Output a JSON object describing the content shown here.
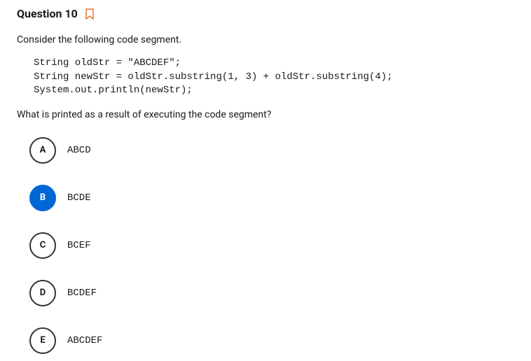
{
  "header": {
    "title": "Question 10"
  },
  "prompt": {
    "intro": "Consider the following code segment.",
    "code": "String oldStr = \"ABCDEF\";\nString newStr = oldStr.substring(1, 3) + oldStr.substring(4);\nSystem.out.println(newStr);",
    "question": "What is printed as a result of executing the code segment?"
  },
  "options": {
    "a": {
      "letter": "A",
      "text": "ABCD"
    },
    "b": {
      "letter": "B",
      "text": "BCDE"
    },
    "c": {
      "letter": "C",
      "text": "BCEF"
    },
    "d": {
      "letter": "D",
      "text": "BCDEF"
    },
    "e": {
      "letter": "E",
      "text": "ABCDEF"
    }
  },
  "selected": "b"
}
